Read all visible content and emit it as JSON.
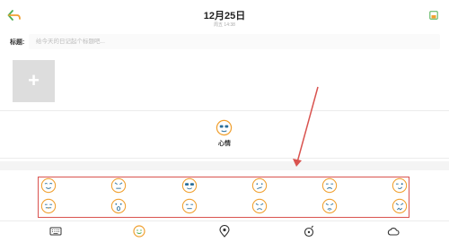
{
  "header": {
    "back_icon": "back-arrow-icon",
    "date": "12月25日",
    "subtitle": "周五 14:38",
    "save_icon": "save-icon"
  },
  "title_row": {
    "label": "标题:",
    "placeholder": "给今天的日记起个标题吧..."
  },
  "photo": {
    "add_glyph": "+"
  },
  "mood": {
    "label": "心情",
    "icon": "mood-face-icon"
  },
  "emojis": [
    "smile-face",
    "angry-face",
    "cool-face",
    "annoyed-face",
    "sad-face",
    "wink-face",
    "tongue-face",
    "surprised-face",
    "neutral-face",
    "frown-face",
    "cry-face",
    "upset-face"
  ],
  "toolbar": [
    "keyboard-icon",
    "emoji-icon",
    "location-icon",
    "music-icon",
    "weather-icon"
  ],
  "colors": {
    "accent_green": "#4cae50",
    "emoji_orange": "#f0a030",
    "highlight_red": "#d9534f",
    "arrow_red": "#d9534f"
  }
}
